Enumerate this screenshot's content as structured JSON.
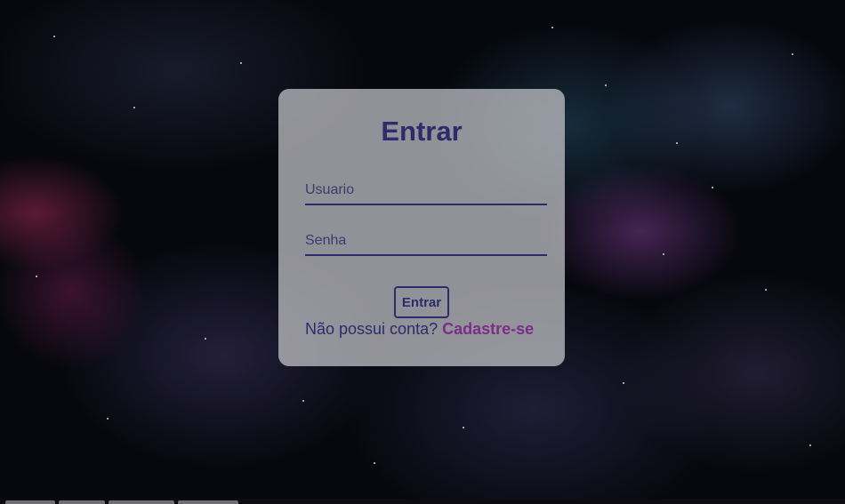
{
  "login": {
    "title": "Entrar",
    "username_placeholder": "Usuario",
    "password_placeholder": "Senha",
    "submit_label": "Entrar",
    "signup_prompt": "Não possui conta?",
    "signup_link": "Cadastre-se"
  },
  "colors": {
    "primary": "#2e2a6b",
    "link": "#7a2e86",
    "card_background": "#c8c8cd"
  }
}
